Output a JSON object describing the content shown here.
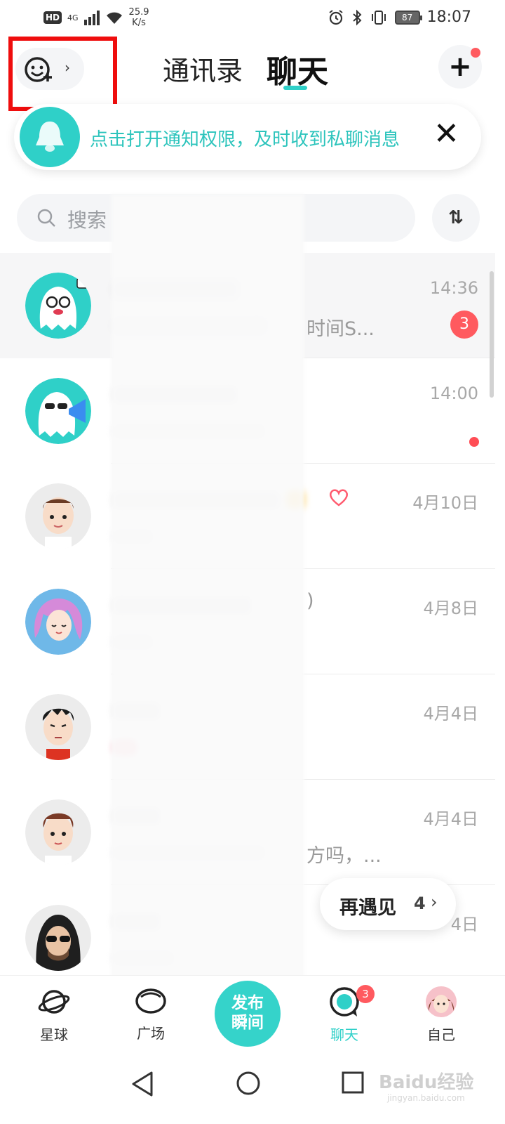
{
  "status_bar": {
    "hd": "HD",
    "network": "4G",
    "speed_value": "25.9",
    "speed_unit": "K/s",
    "battery": "87",
    "time": "18:07"
  },
  "header": {
    "tab_contacts": "通讯录",
    "tab_chat": "聊天",
    "add_friend_chevron": "›",
    "plus": "+"
  },
  "notice": {
    "text": "点击打开通知权限，及时收到私聊消息",
    "close": "✕"
  },
  "search": {
    "placeholder": "搜索",
    "sort_icon": "⇅"
  },
  "chats": [
    {
      "time": "14:36",
      "preview": "时间S...",
      "unread": "3"
    },
    {
      "time": "14:00",
      "preview": ""
    },
    {
      "time": "4月10日",
      "preview": ""
    },
    {
      "time": "4月8日",
      "preview": ")"
    },
    {
      "time": "4月4日",
      "preview": ""
    },
    {
      "time": "4月4日",
      "preview": "方吗，..."
    },
    {
      "time": "4日",
      "preview": ""
    }
  ],
  "meet_again": {
    "label": "再遇见",
    "count": "4",
    "chevron": "›"
  },
  "bottom_nav": {
    "planet": "星球",
    "square": "广场",
    "publish_line1": "发布",
    "publish_line2": "瞬间",
    "chat": "聊天",
    "chat_badge": "3",
    "me": "自己"
  },
  "watermark": {
    "text": "Baidu经验",
    "sub": "jingyan.baidu.com"
  },
  "colors": {
    "accent": "#2fd0c8",
    "badge": "#ff5a5f",
    "highlight": "#ef0d0d"
  }
}
